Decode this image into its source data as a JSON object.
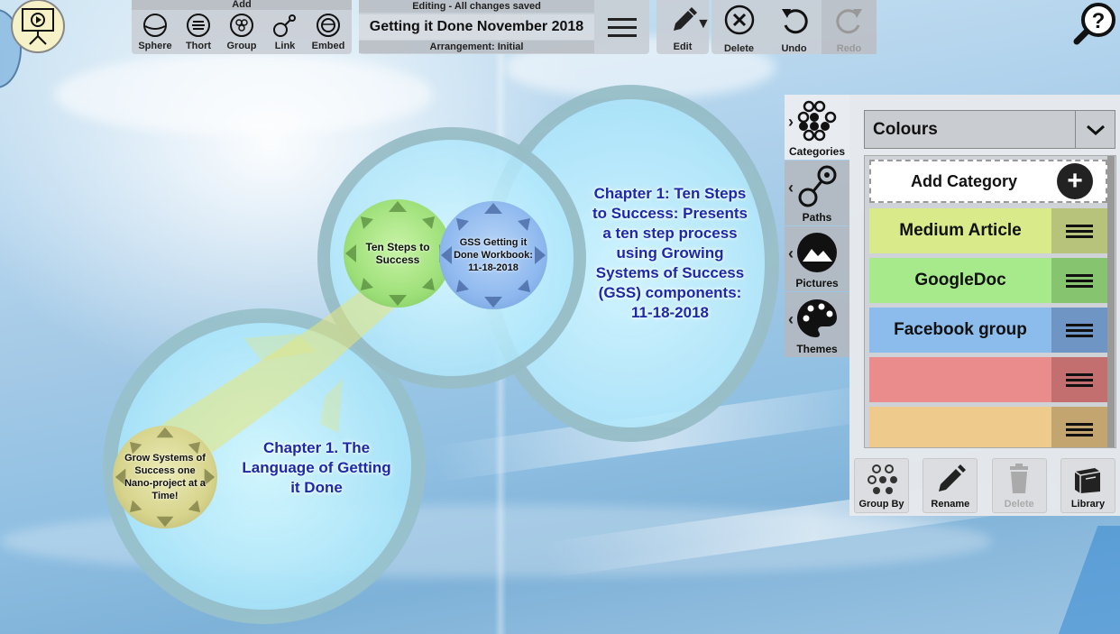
{
  "toolbar": {
    "add_header": "Add",
    "add_buttons": [
      {
        "label": "Sphere",
        "icon": "sphere-icon"
      },
      {
        "label": "Thort",
        "icon": "thort-icon"
      },
      {
        "label": "Group",
        "icon": "group-icon"
      },
      {
        "label": "Link",
        "icon": "link-icon"
      },
      {
        "label": "Embed",
        "icon": "embed-icon"
      }
    ],
    "status": "Editing - All changes saved",
    "map_title": "Getting it Done November 2018",
    "arrangement": "Arrangement: Initial",
    "edit_label": "Edit",
    "delete_label": "Delete",
    "undo_label": "Undo",
    "redo_label": "Redo"
  },
  "map": {
    "big_sphere_title": "Chapter 1: Ten Steps to Success: Presents a ten step process using Growing Systems of Success (GSS) components: 11-18-2018",
    "low_sphere_title": "Chapter 1. The Language of Getting it Done",
    "nodes": {
      "ten_steps": "Ten Steps to Success",
      "gss_workbook": "GSS Getting it Done Workbook: 11-18-2018",
      "grow_systems": "Grow Systems of Success one Nano-project at a Time!"
    },
    "colors": {
      "green_node": "#9fe07a",
      "blue_node": "#8fb9ef",
      "olive_node": "#d7d48d",
      "sphere_text": "#1a2aa8"
    }
  },
  "side_tabs": [
    {
      "label": "Categories",
      "icon": "categories-icon",
      "active": true
    },
    {
      "label": "Paths",
      "icon": "paths-icon"
    },
    {
      "label": "Pictures",
      "icon": "pictures-icon"
    },
    {
      "label": "Themes",
      "icon": "themes-icon"
    }
  ],
  "panel": {
    "dropdown_value": "Colours",
    "add_category": "Add Category",
    "categories": [
      {
        "name": "Medium Article",
        "color": "#d8ea8a",
        "handle_color": "#b7c27a"
      },
      {
        "name": "GoogleDoc",
        "color": "#a6ea8c",
        "handle_color": "#86c46f"
      },
      {
        "name": "Facebook group",
        "color": "#8cbcec",
        "handle_color": "#6f95c4"
      },
      {
        "name": "",
        "color": "#ea8c8c",
        "handle_color": "#c46f6f"
      },
      {
        "name": "",
        "color": "#eecb8c",
        "handle_color": "#c3a56f"
      }
    ],
    "bottom_buttons": [
      {
        "label": "Group By",
        "icon": "group-by-icon"
      },
      {
        "label": "Rename",
        "icon": "pencil-icon"
      },
      {
        "label": "Delete",
        "icon": "trash-icon",
        "disabled": true
      },
      {
        "label": "Library",
        "icon": "library-icon"
      }
    ]
  }
}
